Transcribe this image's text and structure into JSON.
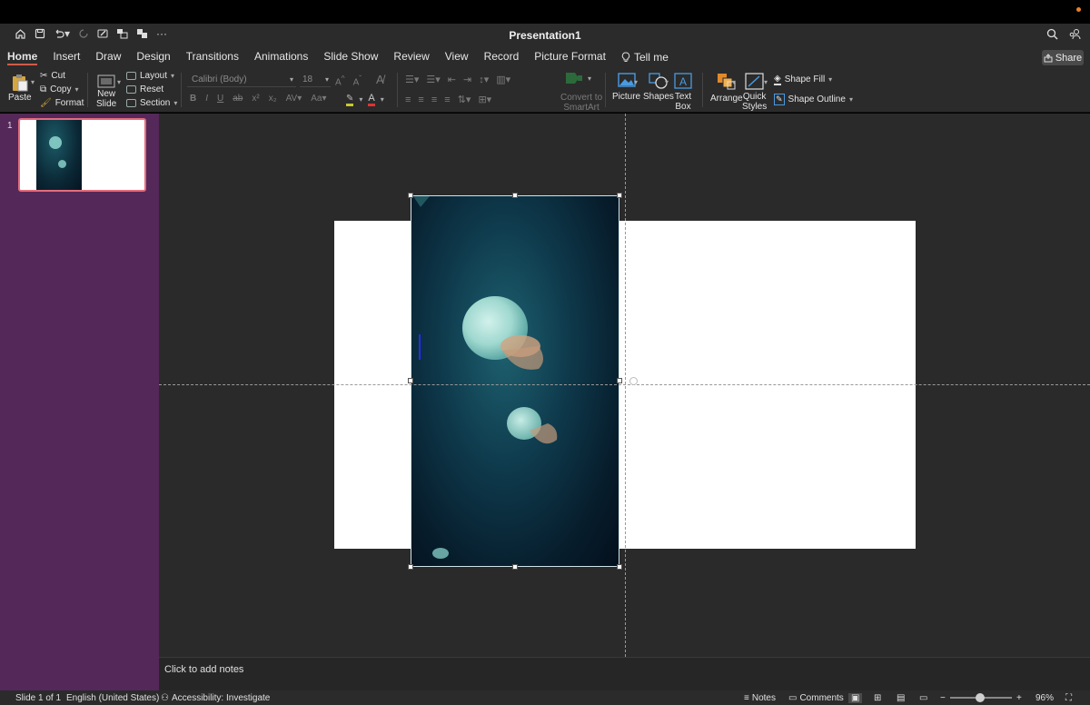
{
  "window": {
    "title": "Presentation1",
    "more_label": "···"
  },
  "tabs": [
    {
      "label": "Home",
      "active": true
    },
    {
      "label": "Insert"
    },
    {
      "label": "Draw"
    },
    {
      "label": "Design"
    },
    {
      "label": "Transitions"
    },
    {
      "label": "Animations"
    },
    {
      "label": "Slide Show"
    },
    {
      "label": "Review"
    },
    {
      "label": "View"
    },
    {
      "label": "Record"
    },
    {
      "label": "Picture Format"
    }
  ],
  "tell_me": "Tell me",
  "share_label": "Share",
  "ribbon": {
    "paste": "Paste",
    "cut": "Cut",
    "copy": "Copy",
    "format": "Format",
    "new_slide_1": "New",
    "new_slide_2": "Slide",
    "layout": "Layout",
    "reset": "Reset",
    "section": "Section",
    "font_name": "Calibri (Body)",
    "font_size": "18",
    "convert_1": "Convert to",
    "convert_2": "SmartArt",
    "picture": "Picture",
    "shapes": "Shapes",
    "textbox_1": "Text",
    "textbox_2": "Box",
    "arrange": "Arrange",
    "quick_1": "Quick",
    "quick_2": "Styles",
    "shape_fill": "Shape Fill",
    "shape_outline": "Shape Outline"
  },
  "slides_panel": {
    "slide_number": "1"
  },
  "notes_placeholder": "Click to add notes",
  "status": {
    "slide_of": "Slide 1 of 1",
    "language": "English (United States)",
    "accessibility": "Accessibility: Investigate",
    "notes": "Notes",
    "comments": "Comments",
    "zoom": "96%"
  },
  "colors": {
    "accent_tab": "#d25a4a",
    "slide_panel": "#55285a",
    "thumb_border": "#e46c7c"
  }
}
